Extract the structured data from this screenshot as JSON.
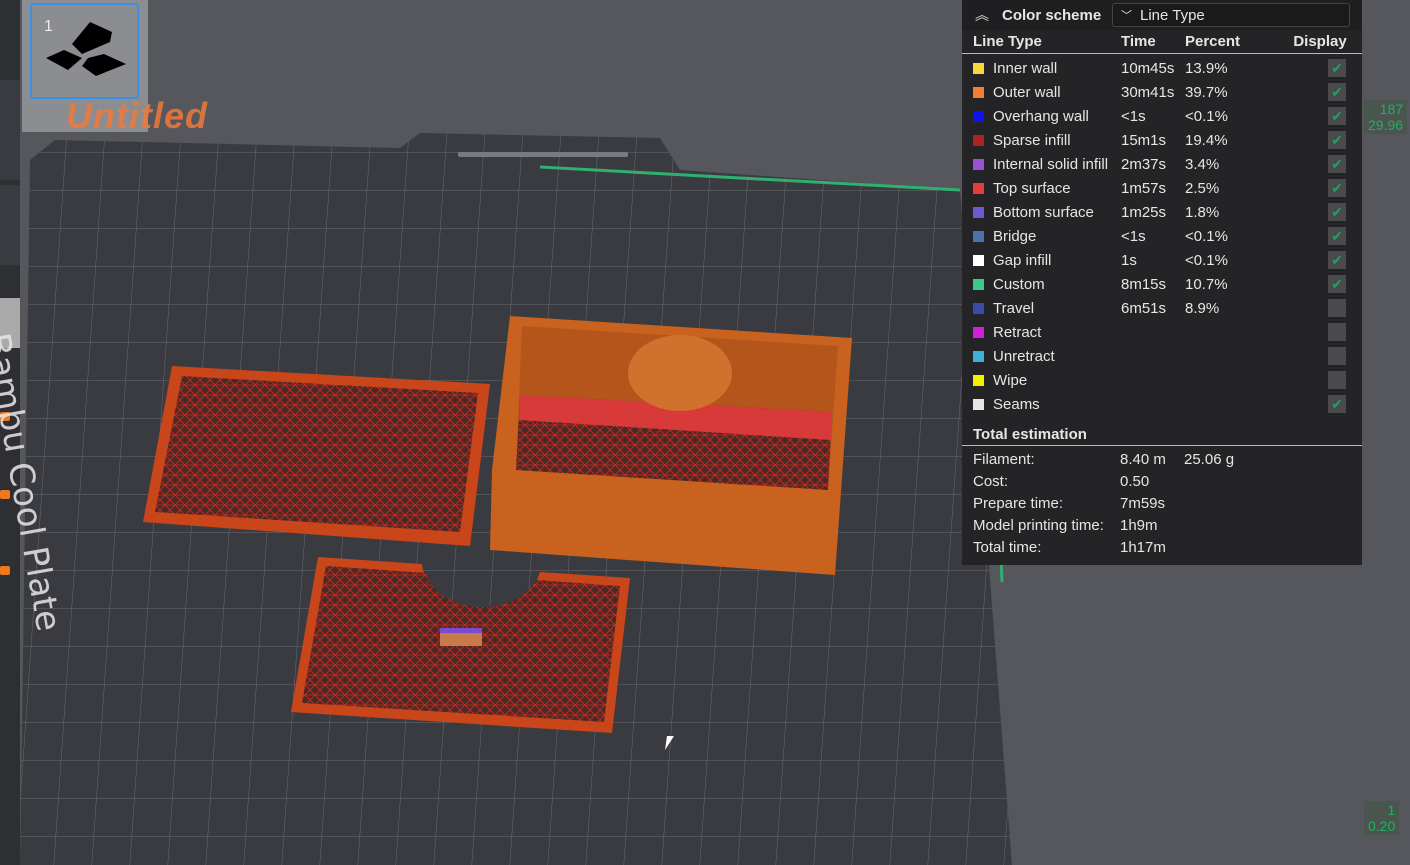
{
  "plate": {
    "number": "1",
    "project_title": "Untitled",
    "bed_label": "Bambu Cool Plate"
  },
  "legend": {
    "color_scheme_label": "Color scheme",
    "scheme_value": "Line Type",
    "columns": [
      "Line Type",
      "Time",
      "Percent",
      "Display"
    ],
    "rows": [
      {
        "name": "Inner wall",
        "time": "10m45s",
        "percent": "13.9%",
        "color": "#f5d93c",
        "display": true
      },
      {
        "name": "Outer wall",
        "time": "30m41s",
        "percent": "39.7%",
        "color": "#f47c34",
        "display": true
      },
      {
        "name": "Overhang wall",
        "time": "<1s",
        "percent": "<0.1%",
        "color": "#1010f0",
        "display": true
      },
      {
        "name": "Sparse infill",
        "time": "15m1s",
        "percent": "19.4%",
        "color": "#b02222",
        "display": true
      },
      {
        "name": "Internal solid infill",
        "time": "2m37s",
        "percent": "3.4%",
        "color": "#9652d0",
        "display": true
      },
      {
        "name": "Top surface",
        "time": "1m57s",
        "percent": "2.5%",
        "color": "#e83c3c",
        "display": true
      },
      {
        "name": "Bottom surface",
        "time": "1m25s",
        "percent": "1.8%",
        "color": "#6a5ad0",
        "display": true
      },
      {
        "name": "Bridge",
        "time": "<1s",
        "percent": "<0.1%",
        "color": "#4f6fb0",
        "display": true
      },
      {
        "name": "Gap infill",
        "time": "1s",
        "percent": "<0.1%",
        "color": "#ffffff",
        "display": true
      },
      {
        "name": "Custom",
        "time": "8m15s",
        "percent": "10.7%",
        "color": "#3cc88a",
        "display": true
      },
      {
        "name": "Travel",
        "time": "6m51s",
        "percent": "8.9%",
        "color": "#3a4aa8",
        "display": false
      },
      {
        "name": "Retract",
        "time": "",
        "percent": "",
        "color": "#d020d8",
        "display": false
      },
      {
        "name": "Unretract",
        "time": "",
        "percent": "",
        "color": "#40b0d8",
        "display": false
      },
      {
        "name": "Wipe",
        "time": "",
        "percent": "",
        "color": "#f0f000",
        "display": false
      },
      {
        "name": "Seams",
        "time": "",
        "percent": "",
        "color": "#e6e6e6",
        "display": true
      }
    ],
    "total_label": "Total estimation",
    "estimation": [
      {
        "key": "Filament:",
        "value": "8.40 m",
        "extra": "25.06 g"
      },
      {
        "key": "Cost:",
        "value": "0.50",
        "extra": ""
      },
      {
        "key": "Prepare time:",
        "value": "7m59s",
        "extra": ""
      },
      {
        "key": "Model printing time:",
        "value": "1h9m",
        "extra": ""
      },
      {
        "key": "Total time:",
        "value": "1h17m",
        "extra": ""
      }
    ]
  },
  "layer_slider": {
    "top_layer": "187",
    "top_height": "29.96",
    "bottom_layer": "1",
    "bottom_height": "0.20"
  }
}
